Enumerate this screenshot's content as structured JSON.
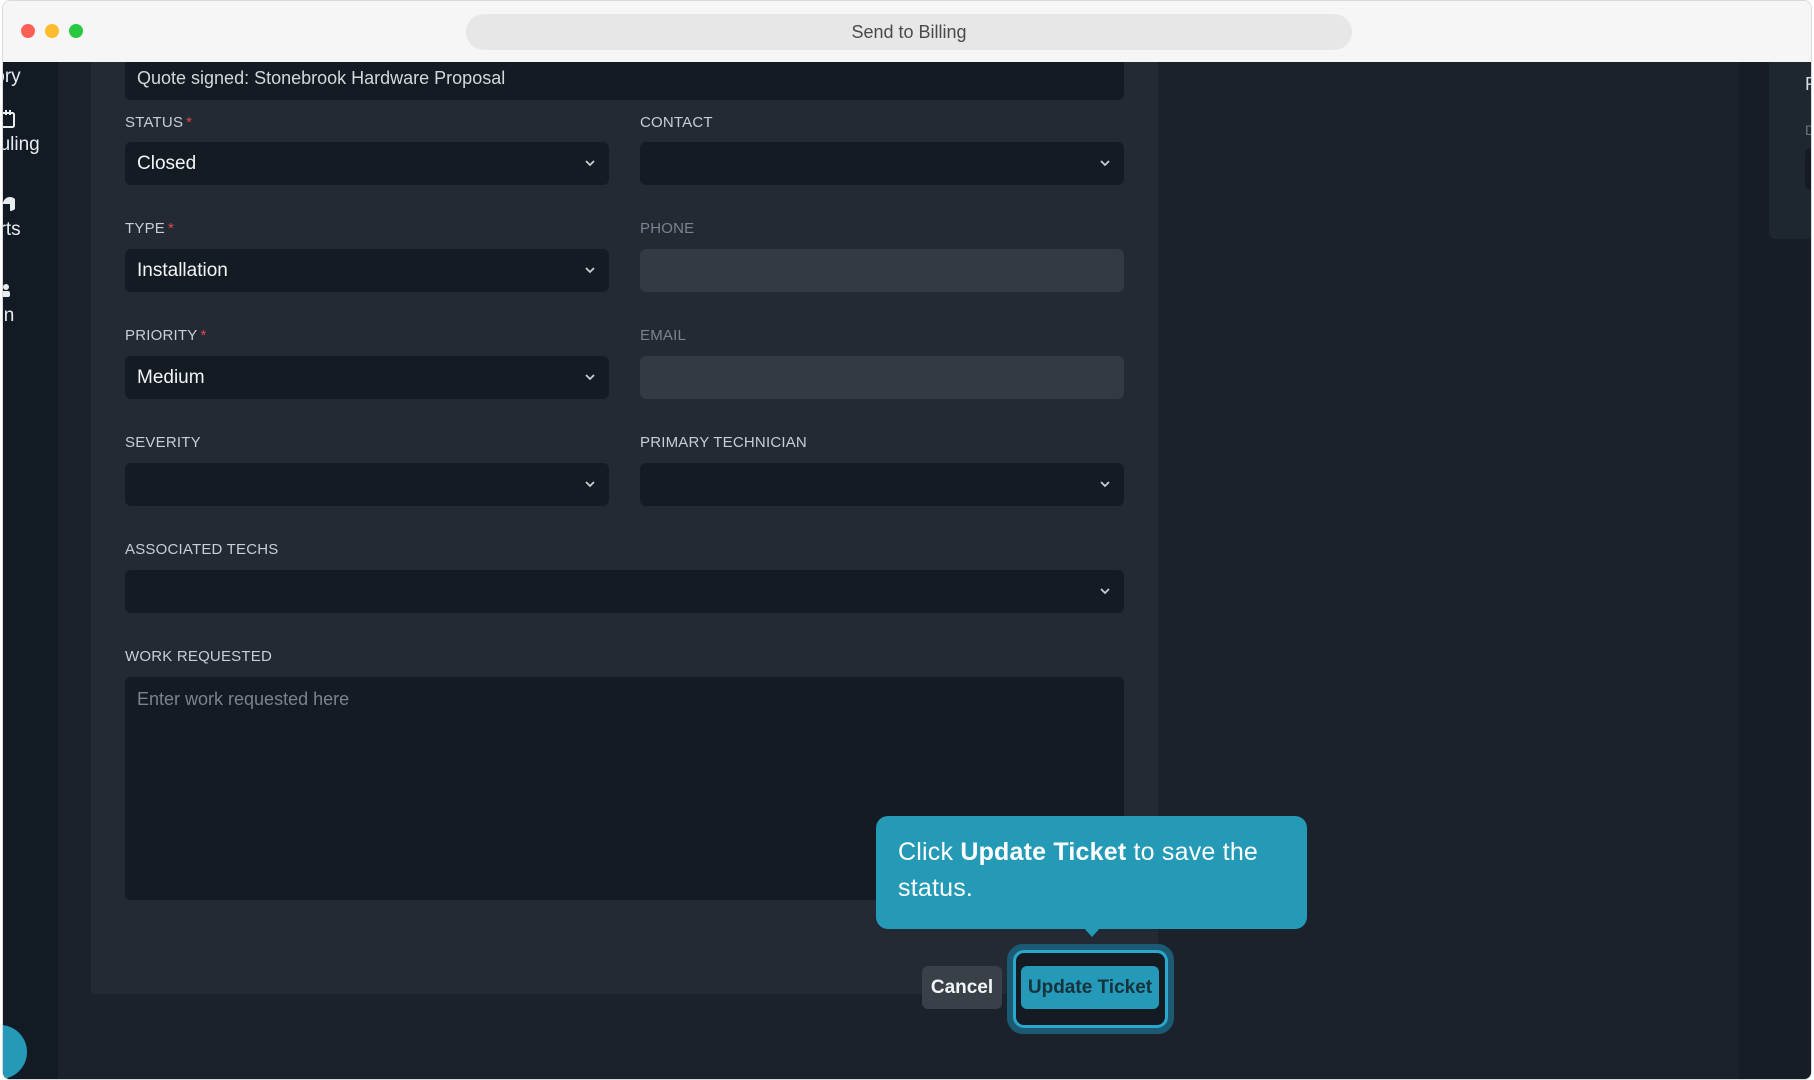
{
  "window": {
    "title": "Send to Billing"
  },
  "sidebar": {
    "items": [
      {
        "label": "tory",
        "icon": ""
      },
      {
        "label": "duling",
        "icon": "calendar-icon"
      },
      {
        "label": "orts",
        "icon": "chart-icon"
      },
      {
        "label": "nin",
        "icon": "user-gear-icon"
      }
    ]
  },
  "right_panel": {
    "label_r": "R",
    "label_d": "D"
  },
  "form": {
    "subject_value": "Quote signed: Stonebrook Hardware Proposal",
    "status": {
      "label": "STATUS",
      "required": "*",
      "value": "Closed"
    },
    "contact": {
      "label": "CONTACT",
      "value": ""
    },
    "type": {
      "label": "TYPE",
      "required": "*",
      "value": "Installation"
    },
    "phone": {
      "label": "PHONE",
      "value": ""
    },
    "priority": {
      "label": "PRIORITY",
      "required": "*",
      "value": "Medium"
    },
    "email": {
      "label": "EMAIL",
      "value": ""
    },
    "severity": {
      "label": "SEVERITY",
      "value": ""
    },
    "primary_technician": {
      "label": "PRIMARY TECHNICIAN",
      "value": ""
    },
    "associated_techs": {
      "label": "ASSOCIATED TECHS",
      "value": ""
    },
    "work_requested": {
      "label": "WORK REQUESTED",
      "placeholder": "Enter work requested here",
      "value": ""
    }
  },
  "actions": {
    "cancel": "Cancel",
    "update": "Update Ticket"
  },
  "tooltip": {
    "prefix": "Click ",
    "bold": "Update Ticket",
    "suffix": " to save the status."
  },
  "colors": {
    "accent": "#2499b8",
    "required": "#e0454f",
    "background": "#1b222c"
  }
}
